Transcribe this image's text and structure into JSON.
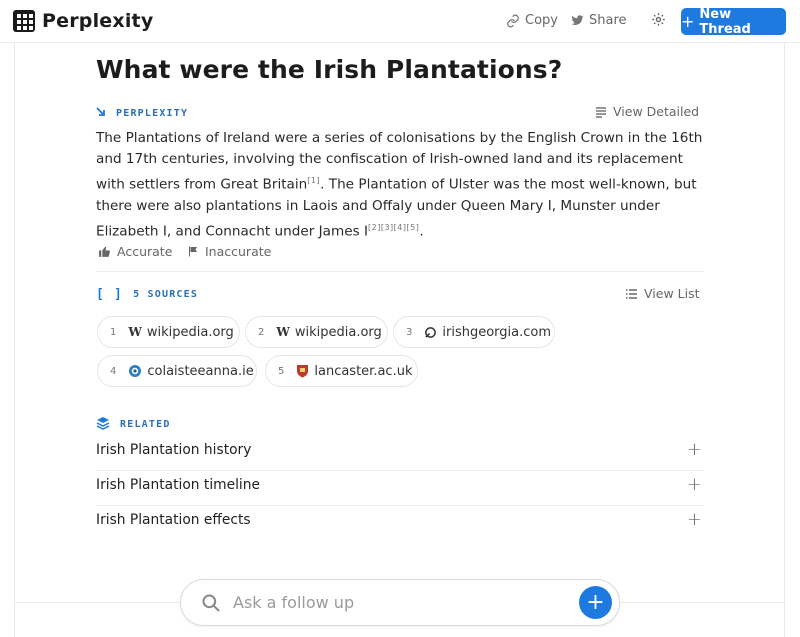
{
  "header": {
    "app_name": "Perplexity",
    "copy_label": "Copy",
    "share_label": "Share",
    "new_thread_label": "New Thread"
  },
  "thread": {
    "title": "What were the Irish Plantations?"
  },
  "answer": {
    "section_label": "PERPLEXITY",
    "view_detailed_label": "View Detailed",
    "text_part1": "The Plantations of Ireland were a series of colonisations by the English Crown in the 16th and 17th centuries, involving the confiscation of Irish-owned land and its replacement with settlers from Great Britain",
    "cite1": "[1]",
    "text_part2": ". The Plantation of Ulster was the most well-known, but there were also plantations in Laois and Offaly under Queen Mary I, Munster under Elizabeth I, and Connacht under James I",
    "cite2": "[2][3][4][5]",
    "text_part3": ".",
    "accurate_label": "Accurate",
    "inaccurate_label": "Inaccurate"
  },
  "sources": {
    "section_label": "5 SOURCES",
    "view_list_label": "View List",
    "items": [
      {
        "num": "1",
        "icon": "wikipedia-icon",
        "domain": "wikipedia.org"
      },
      {
        "num": "2",
        "icon": "wikipedia-icon",
        "domain": "wikipedia.org"
      },
      {
        "num": "3",
        "icon": "irishgeorgia-icon",
        "domain": "irishgeorgia.com"
      },
      {
        "num": "4",
        "icon": "colaisteeanna-icon",
        "domain": "colaisteeanna.ie"
      },
      {
        "num": "5",
        "icon": "lancaster-icon",
        "domain": "lancaster.ac.uk"
      }
    ]
  },
  "related": {
    "section_label": "RELATED",
    "items": [
      {
        "label": "Irish Plantation history"
      },
      {
        "label": "Irish Plantation timeline"
      },
      {
        "label": "Irish Plantation effects"
      }
    ]
  },
  "followup": {
    "placeholder": "Ask a follow up"
  },
  "colors": {
    "accent": "#1f7ae0",
    "label_blue": "#2b6fb8"
  }
}
